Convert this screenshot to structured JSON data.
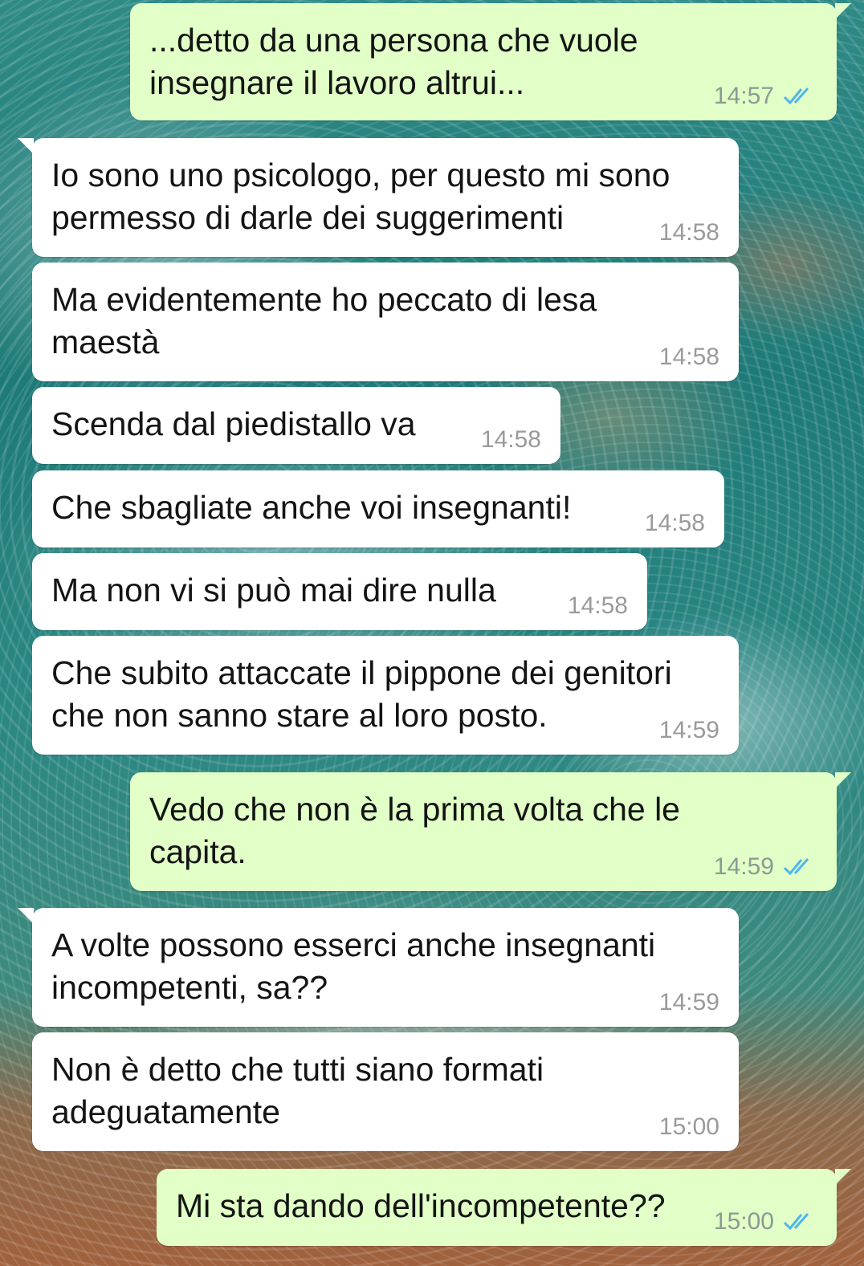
{
  "messages": [
    {
      "dir": "out",
      "text_lines": [
        "...detto da una persona che vuole",
        "insegnare il lavoro altrui..."
      ],
      "time": "14:57",
      "read": true
    },
    {
      "dir": "in",
      "text_lines": [
        "Io sono uno psicologo, per questo mi sono",
        "permesso di darle dei suggerimenti"
      ],
      "time": "14:58"
    },
    {
      "dir": "in",
      "text_lines": [
        "Ma evidentemente ho peccato di lesa",
        "maestà"
      ],
      "time": "14:58"
    },
    {
      "dir": "in",
      "text_lines": [
        "Scenda dal piedistallo va"
      ],
      "time": "14:58"
    },
    {
      "dir": "in",
      "text_lines": [
        "Che sbagliate anche voi insegnanti!"
      ],
      "time": "14:58"
    },
    {
      "dir": "in",
      "text_lines": [
        "Ma non vi si può mai dire nulla"
      ],
      "time": "14:58"
    },
    {
      "dir": "in",
      "text_lines": [
        "Che subito attaccate il pippone dei genitori",
        "che non sanno stare al loro posto."
      ],
      "time": "14:59"
    },
    {
      "dir": "out",
      "text_lines": [
        "Vedo che non è la prima volta che le",
        "capita."
      ],
      "time": "14:59",
      "read": true
    },
    {
      "dir": "in",
      "text_lines": [
        "A volte possono esserci anche insegnanti",
        "incompetenti, sa??"
      ],
      "time": "14:59"
    },
    {
      "dir": "in",
      "text_lines": [
        "Non è detto che tutti siano formati",
        "adeguatamente"
      ],
      "time": "15:00"
    },
    {
      "dir": "out",
      "text_lines": [
        "Mi sta dando dell'incompetente??"
      ],
      "time": "15:00",
      "read": true
    }
  ],
  "icons": {
    "read_receipt": "double-check-icon"
  },
  "colors": {
    "outgoing_bubble": "#e1ffc7",
    "incoming_bubble": "#ffffff",
    "read_tick": "#4fb6ec",
    "timestamp": "#9a9a9a"
  }
}
